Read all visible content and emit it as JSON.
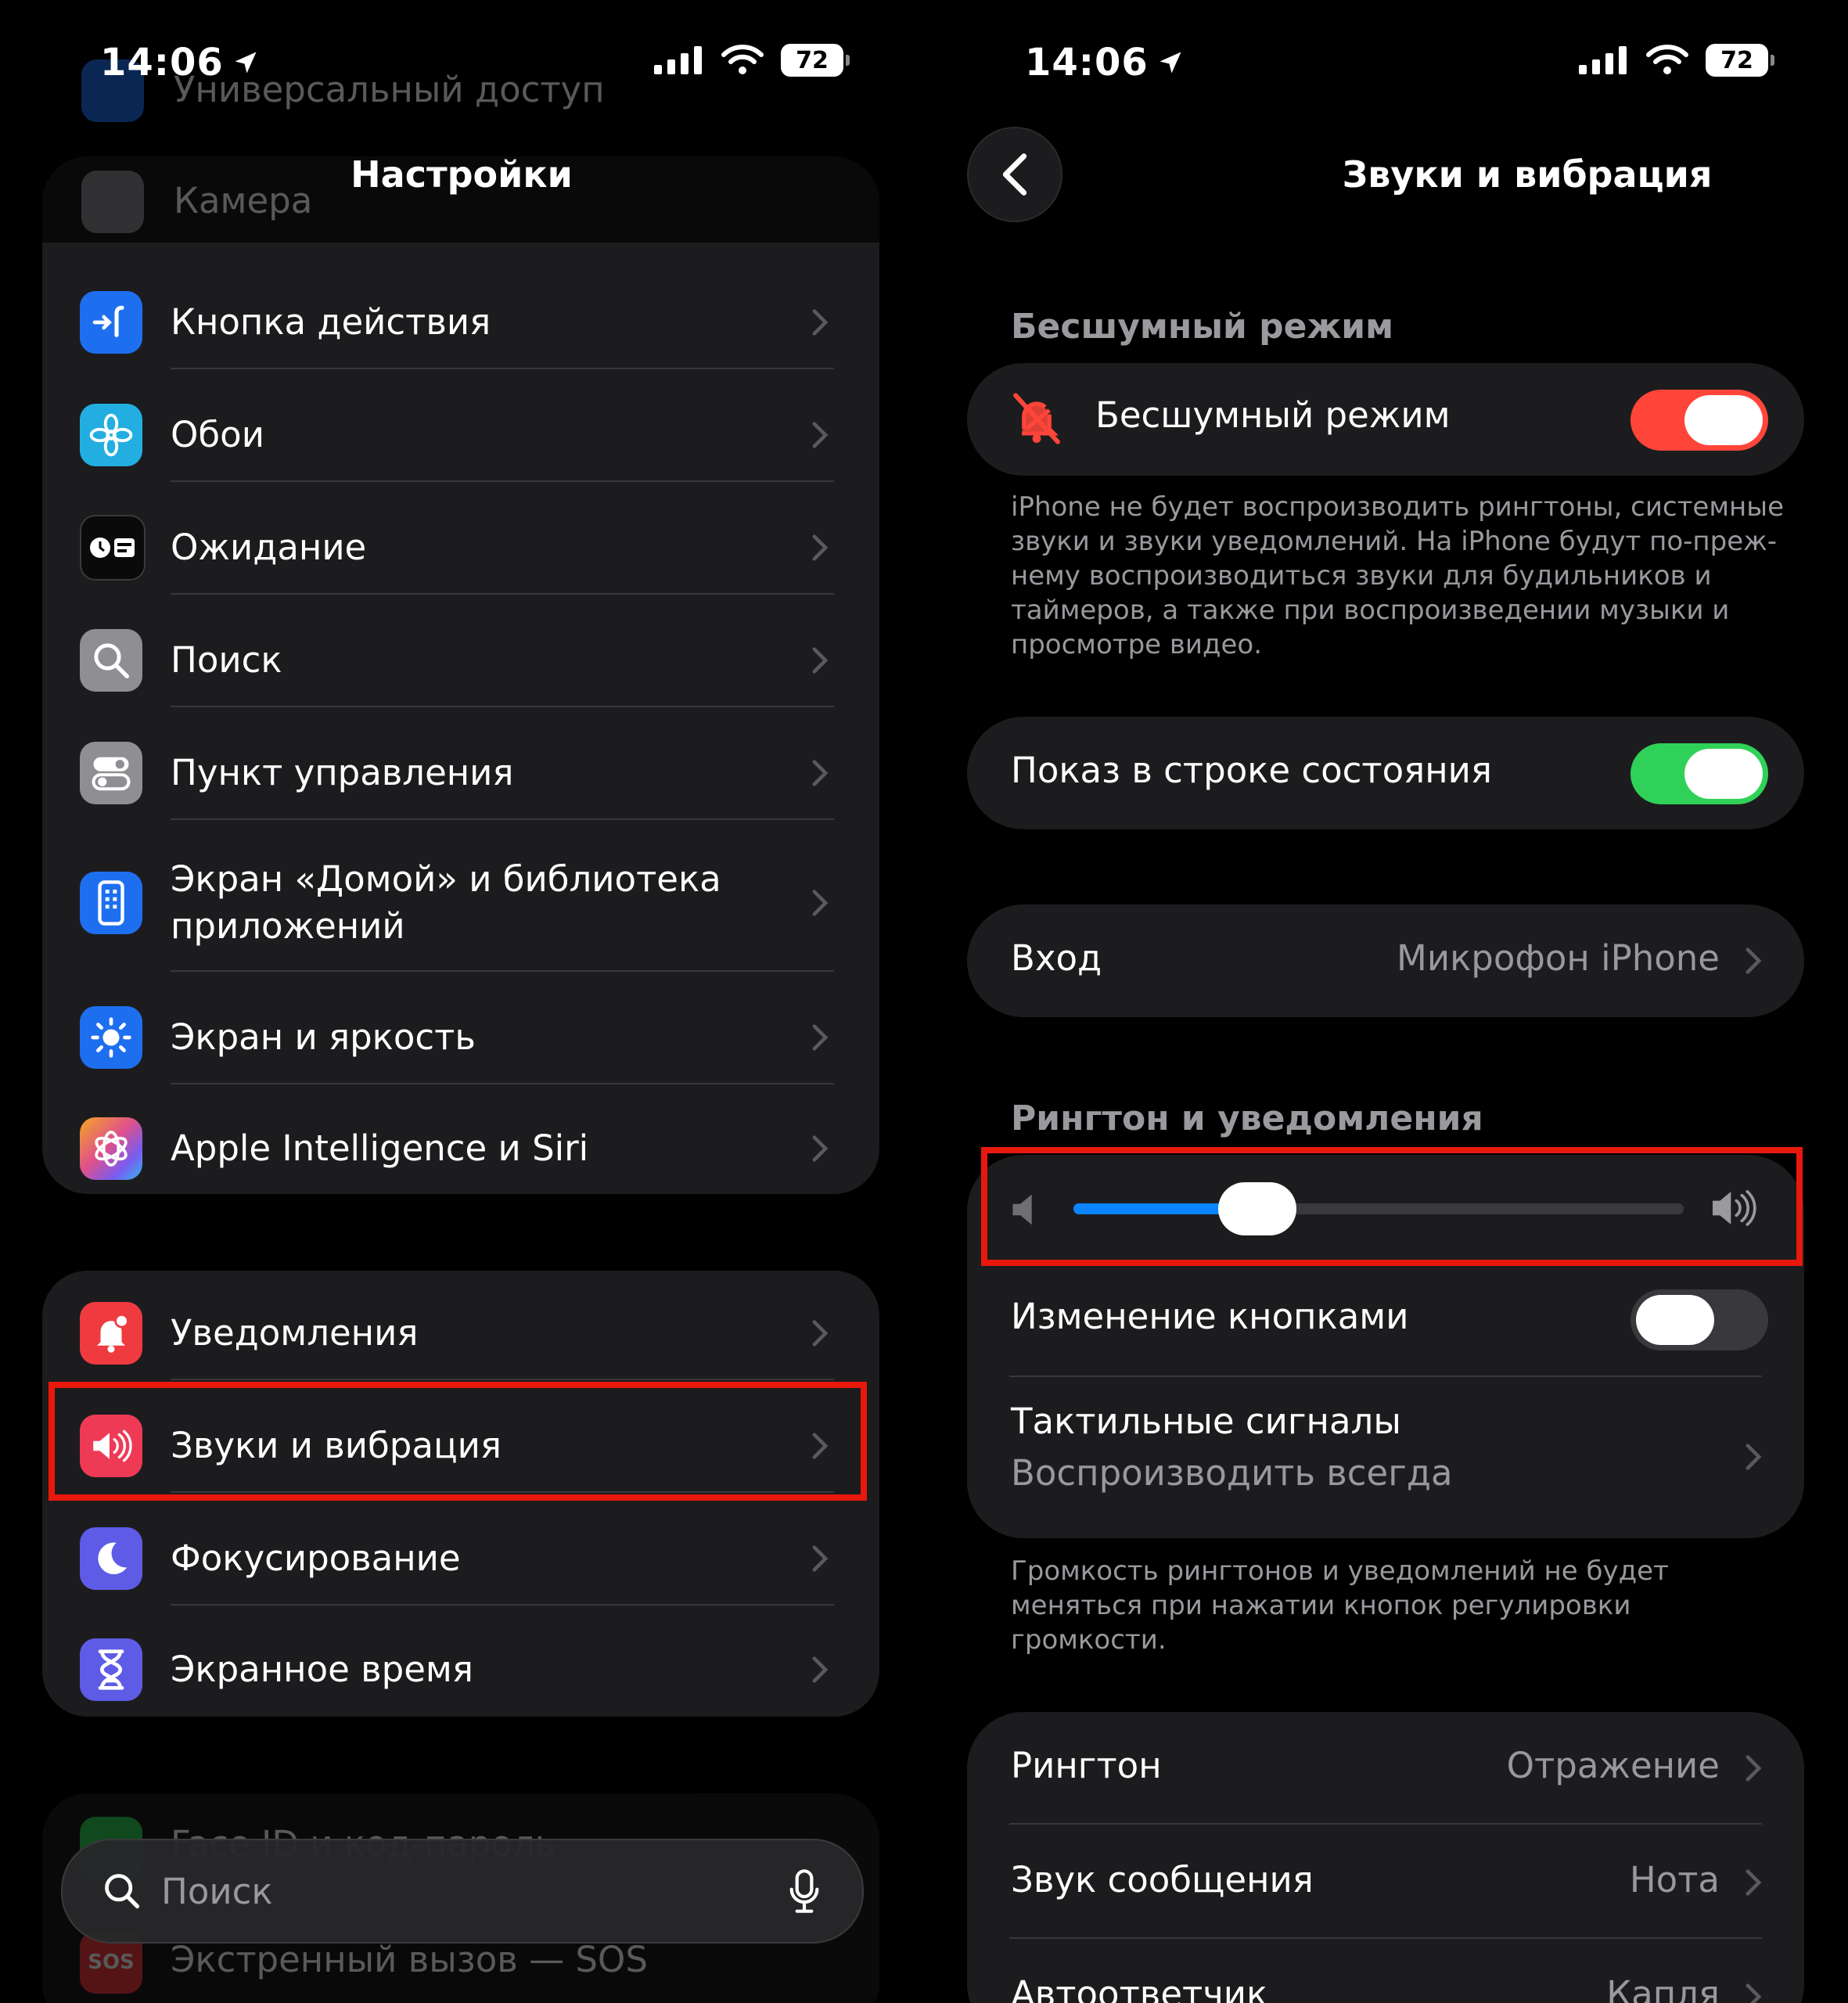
{
  "status_bar": {
    "time": "14:06",
    "battery": "72"
  },
  "left": {
    "title": "Настройки",
    "faded_top": {
      "accessibility": "Универсальный доступ",
      "camera": "Камера"
    },
    "group1": [
      {
        "label": "Кнопка действия",
        "icon": "action-button-icon",
        "color": "#1e6ff0"
      },
      {
        "label": "Обои",
        "icon": "flower-icon",
        "color": "#22aee0"
      },
      {
        "label": "Ожидание",
        "icon": "standby-icon",
        "color": "#0a0a0a"
      },
      {
        "label": "Поиск",
        "icon": "magnifier-icon",
        "color": "#8e8e93"
      },
      {
        "label": "Пункт управления",
        "icon": "toggles-icon",
        "color": "#8e8e93"
      },
      {
        "label": "Экран «Домой» и библиотека приложений",
        "icon": "home-screen-icon",
        "color": "#1e6ff0"
      },
      {
        "label": "Экран и яркость",
        "icon": "sun-icon",
        "color": "#1e6ff0"
      },
      {
        "label": "Apple Intelligence и Siri",
        "icon": "siri-icon",
        "color": "#e0508a"
      }
    ],
    "group2": [
      {
        "label": "Уведомления",
        "icon": "bell-icon",
        "color": "#ef3a3f"
      },
      {
        "label": "Звуки и вибрация",
        "icon": "speaker-icon",
        "color": "#ef3a56"
      },
      {
        "label": "Фокусирование",
        "icon": "moon-icon",
        "color": "#5e5ce6"
      },
      {
        "label": "Экранное время",
        "icon": "hourglass-icon",
        "color": "#5e5ce6"
      }
    ],
    "faded_bottom": {
      "faceid": "Face ID и код-пароль",
      "sos": "Экстренный вызов — SOS"
    },
    "search_placeholder": "Поиск"
  },
  "right": {
    "title": "Звуки и вибрация",
    "silent_header": "Бесшумный режим",
    "silent_label": "Бесшумный режим",
    "silent_note": "iPhone не будет воспроизводить рингтоны, системные звуки и звуки уведомлений. На iPhone будут по-преж-нему воспроизводиться звуки для будильников и таймеров, а также при воспроизведении музыки и просмотре видео.",
    "status_bar_label": "Показ в строке состояния",
    "input_label": "Вход",
    "input_value": "Микрофон iPhone",
    "ringtone_header": "Рингтон и уведомления",
    "volume_level": 0.25,
    "change_buttons_label": "Изменение кнопками",
    "haptics_label": "Тактильные сигналы",
    "haptics_value": "Воспроизводить всегда",
    "volume_note": "Громкость рингтонов и уведомлений не будет меняться при нажатии кнопок регулировки громкости.",
    "ringtone_label": "Рингтон",
    "ringtone_value": "Отражение",
    "message_label": "Звук сообщения",
    "message_value": "Нота",
    "voicemail_label": "Автоответчик",
    "voicemail_value": "Капля",
    "colors": {
      "silent_toggle": "#ff453a",
      "status_toggle": "#30d158",
      "slider_fill": "#0a84ff",
      "highlight": "#e8180c"
    }
  }
}
